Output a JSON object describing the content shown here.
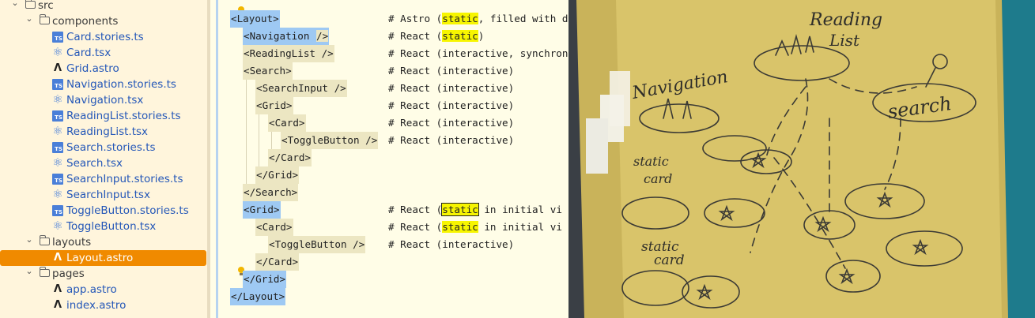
{
  "tree": {
    "items": [
      {
        "label": "src",
        "type": "dir",
        "expanded": true,
        "depth": 0,
        "row": 0
      },
      {
        "label": "components",
        "type": "dir",
        "expanded": true,
        "depth": 1,
        "row": 1
      },
      {
        "label": "Card.stories.ts",
        "type": "ts",
        "depth": 2,
        "row": 2
      },
      {
        "label": "Card.tsx",
        "type": "tsx",
        "depth": 2,
        "row": 3
      },
      {
        "label": "Grid.astro",
        "type": "astro",
        "depth": 2,
        "row": 4
      },
      {
        "label": "Navigation.stories.ts",
        "type": "ts",
        "depth": 2,
        "row": 5
      },
      {
        "label": "Navigation.tsx",
        "type": "tsx",
        "depth": 2,
        "row": 6
      },
      {
        "label": "ReadingList.stories.ts",
        "type": "ts",
        "depth": 2,
        "row": 7
      },
      {
        "label": "ReadingList.tsx",
        "type": "tsx",
        "depth": 2,
        "row": 8
      },
      {
        "label": "Search.stories.ts",
        "type": "ts",
        "depth": 2,
        "row": 9
      },
      {
        "label": "Search.tsx",
        "type": "tsx",
        "depth": 2,
        "row": 10
      },
      {
        "label": "SearchInput.stories.ts",
        "type": "ts",
        "depth": 2,
        "row": 11
      },
      {
        "label": "SearchInput.tsx",
        "type": "tsx",
        "depth": 2,
        "row": 12
      },
      {
        "label": "ToggleButton.stories.ts",
        "type": "ts",
        "depth": 2,
        "row": 13
      },
      {
        "label": "ToggleButton.tsx",
        "type": "tsx",
        "depth": 2,
        "row": 14
      },
      {
        "label": "layouts",
        "type": "dir",
        "expanded": true,
        "depth": 1,
        "row": 15
      },
      {
        "label": "Layout.astro",
        "type": "astro",
        "depth": 2,
        "row": 16,
        "selected": true
      },
      {
        "label": "pages",
        "type": "dir",
        "expanded": true,
        "depth": 1,
        "row": 17
      },
      {
        "label": "app.astro",
        "type": "astro",
        "depth": 2,
        "row": 18
      },
      {
        "label": "index.astro",
        "type": "astro",
        "depth": 2,
        "row": 19
      }
    ],
    "selected_color": "#f08a00"
  },
  "editor": {
    "lines": [
      {
        "row": 1,
        "indent": 0,
        "tag": "<Layout>",
        "sel": true,
        "segments": [
          {
            "t": "# Astro ("
          },
          {
            "t": "static",
            "hl": "y"
          },
          {
            "t": ", filled with dynamic data in build-time)"
          }
        ]
      },
      {
        "row": 2,
        "indent": 1,
        "tag": "<Navigation ",
        "sel": true,
        "tag_tail": "/>",
        "caret": true,
        "segments": [
          {
            "t": "# React ("
          },
          {
            "t": "static",
            "hl": "y"
          },
          {
            "t": ")"
          }
        ]
      },
      {
        "row": 3,
        "indent": 1,
        "tag": "<ReadingList />",
        "segments": [
          {
            "t": "# React (interactive, synchronize with local storage and/or API)"
          }
        ]
      },
      {
        "row": 4,
        "indent": 1,
        "tag": "<Search>",
        "segments": [
          {
            "t": "# React (interactive)"
          }
        ]
      },
      {
        "row": 5,
        "indent": 2,
        "tag": "<SearchInput />",
        "segments": [
          {
            "t": "# React (interactive)"
          }
        ]
      },
      {
        "row": 6,
        "indent": 2,
        "tag": "<Grid>",
        "segments": [
          {
            "t": "# React (interactive)"
          }
        ]
      },
      {
        "row": 7,
        "indent": 3,
        "tag": "<Card>",
        "segments": [
          {
            "t": "# React (interactive)"
          }
        ]
      },
      {
        "row": 8,
        "indent": 4,
        "tag": "<ToggleButton />",
        "segments": [
          {
            "t": "# React (interactive)"
          }
        ],
        "comment_inline": true
      },
      {
        "row": 9,
        "indent": 3,
        "tag": "</Card>",
        "segments": []
      },
      {
        "row": 10,
        "indent": 2,
        "tag": "</Grid>",
        "segments": []
      },
      {
        "row": 11,
        "indent": 1,
        "tag": "</Search>",
        "segments": []
      },
      {
        "row": 12,
        "indent": 1,
        "tag": "<Grid>",
        "sel": true,
        "segments": [
          {
            "t": "# React ("
          },
          {
            "t": "static",
            "hl": "box"
          },
          {
            "t": " in initial vi"
          }
        ]
      },
      {
        "row": 13,
        "indent": 2,
        "tag": "<Card>",
        "segments": [
          {
            "t": "# React ("
          },
          {
            "t": "static",
            "hl": "y"
          },
          {
            "t": " in initial vi"
          }
        ]
      },
      {
        "row": 14,
        "indent": 3,
        "tag": "<ToggleButton />",
        "segments": [
          {
            "t": "# React (interactive)"
          }
        ]
      },
      {
        "row": 15,
        "indent": 2,
        "tag": "</Card>",
        "segments": []
      },
      {
        "row": 16,
        "indent": 1,
        "tag": "</Grid>",
        "sel": true,
        "segments": []
      },
      {
        "row": 17,
        "indent": 0,
        "tag": "</Layout>",
        "sel": true,
        "segments": []
      }
    ],
    "bulb_rows": [
      0,
      15
    ]
  },
  "sketch": {
    "labels": {
      "reading": "Reading",
      "list": "List",
      "navigation": "Navigation",
      "search": "search",
      "static1": "static",
      "card1": "card",
      "static2": "static",
      "card2": "card"
    }
  }
}
